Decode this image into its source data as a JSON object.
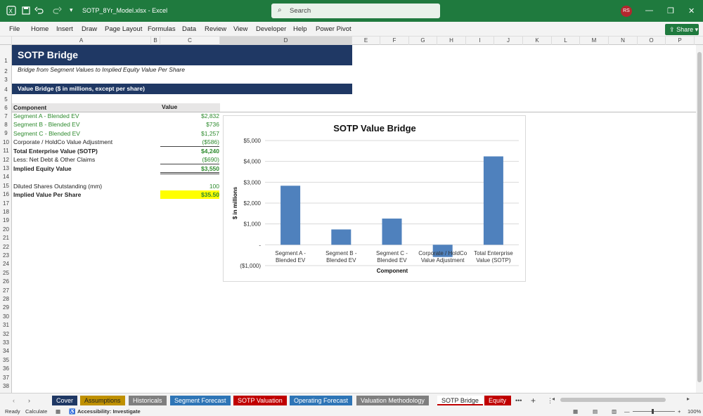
{
  "titlebar": {
    "filename": "SOTP_8Yr_Model.xlsx",
    "app": "Excel",
    "search_placeholder": "Search",
    "avatar": "RS",
    "sep": "-"
  },
  "menu": [
    "File",
    "Home",
    "Insert",
    "Draw",
    "Page Layout",
    "Formulas",
    "Data",
    "Review",
    "View",
    "Developer",
    "Help",
    "Power Pivot"
  ],
  "share_label": "Share",
  "columns": [
    "A",
    "B",
    "C",
    "D",
    "E",
    "F",
    "G",
    "H",
    "I",
    "J",
    "K",
    "L",
    "M",
    "N",
    "O",
    "P"
  ],
  "rows": [
    "1",
    "2",
    "3",
    "4",
    "5",
    "6",
    "7",
    "8",
    "9",
    "10",
    "11",
    "12",
    "13",
    "14",
    "15",
    "16",
    "17",
    "18",
    "19",
    "20",
    "21",
    "22",
    "23",
    "24",
    "25",
    "26",
    "27",
    "28",
    "29",
    "30",
    "31",
    "32",
    "33",
    "34",
    "35",
    "36",
    "37",
    "38"
  ],
  "sheet": {
    "title": "SOTP Bridge",
    "subtitle": "Bridge from Segment Values to Implied Equity Value Per Share",
    "section": "Value Bridge ($ in millions, except per share)",
    "hdr_component": "Component",
    "hdr_value": "Value",
    "r7": {
      "label": "Segment A - Blended EV",
      "value": "$2,832"
    },
    "r8": {
      "label": "Segment B - Blended EV",
      "value": "$736"
    },
    "r9": {
      "label": "Segment C - Blended EV",
      "value": "$1,257"
    },
    "r10": {
      "label": "Corporate / HoldCo Value Adjustment",
      "value": "($586)"
    },
    "r11": {
      "label": "Total Enterprise Value (SOTP)",
      "value": "$4,240"
    },
    "r12": {
      "label": "Less: Net Debt & Other Claims",
      "value": "($690)"
    },
    "r13": {
      "label": "Implied Equity Value",
      "value": "$3,550"
    },
    "r15": {
      "label": "Diluted Shares Outstanding (mm)",
      "value": "100"
    },
    "r16": {
      "label": "Implied Value Per Share",
      "value": "$35.50"
    }
  },
  "chart_data": {
    "type": "bar",
    "title": "SOTP Value Bridge",
    "xlabel": "Component",
    "ylabel": "$ in millions",
    "categories": [
      "Segment A - Blended EV",
      "Segment B - Blended EV",
      "Segment C - Blended EV",
      "Corporate / HoldCo Value Adjustment",
      "Total Enterprise Value (SOTP)"
    ],
    "category_lines": [
      [
        "Segment A -",
        "Blended EV"
      ],
      [
        "Segment B -",
        "Blended EV"
      ],
      [
        "Segment C -",
        "Blended EV"
      ],
      [
        "Corporate / HoldCo",
        "Value Adjustment"
      ],
      [
        "Total Enterprise",
        "Value (SOTP)"
      ]
    ],
    "values": [
      2832,
      736,
      1257,
      -586,
      4240
    ],
    "ylim": [
      -1000,
      5000
    ],
    "yticks": [
      5000,
      4000,
      3000,
      2000,
      1000,
      0,
      -1000
    ],
    "yticklabels": [
      "$5,000",
      "$4,000",
      "$3,000",
      "$2,000",
      "$1,000",
      "-",
      "($1,000)"
    ],
    "grid": true,
    "bar_color": "#4f81bd"
  },
  "tabs": [
    {
      "label": "Cover",
      "color": "#1f3864",
      "text": "#ffffff"
    },
    {
      "label": "Assumptions",
      "color": "#bf9000",
      "text": "#222222"
    },
    {
      "label": "Historicals",
      "color": "#7f7f7f",
      "text": "#ffffff"
    },
    {
      "label": "Segment Forecast",
      "color": "#2e75b6",
      "text": "#ffffff"
    },
    {
      "label": "SOTP Valuation",
      "color": "#c00000",
      "text": "#ffffff"
    },
    {
      "label": "Operating Forecast",
      "color": "#2e75b6",
      "text": "#ffffff"
    },
    {
      "label": "Valuation Methodology",
      "color": "#7f7f7f",
      "text": "#ffffff"
    },
    {
      "label": "SOTP Bridge",
      "color": "#ffffff",
      "text": "#222222"
    },
    {
      "label": "Equity V",
      "color": "#c00000",
      "text": "#ffffff"
    }
  ],
  "tab_more": "•••",
  "tab_add": "+",
  "status": {
    "ready": "Ready",
    "calc": "Calculate",
    "accessibility": "Accessibility: Investigate",
    "zoom": "100%"
  }
}
